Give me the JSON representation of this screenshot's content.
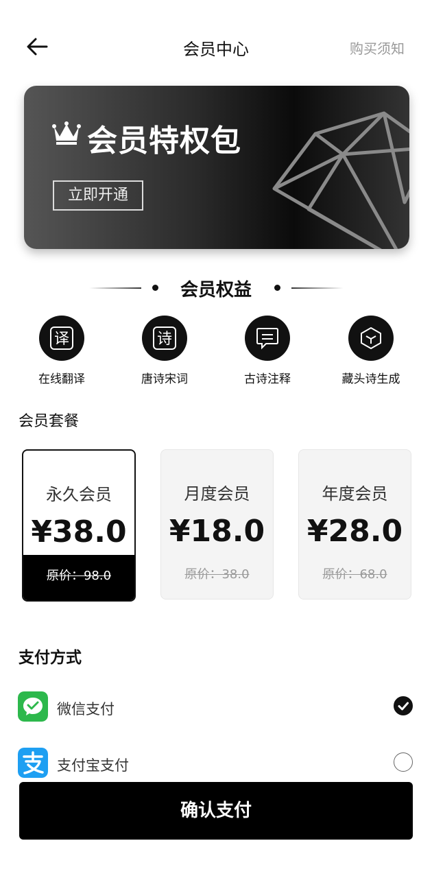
{
  "header": {
    "title": "会员中心",
    "notice_link": "购买须知"
  },
  "banner": {
    "title": "会员特权包",
    "cta": "立即开通"
  },
  "benefits": {
    "heading": "会员权益",
    "items": [
      {
        "label": "在线翻译",
        "glyph": "译",
        "icon": "translate-icon"
      },
      {
        "label": "唐诗宋词",
        "glyph": "诗",
        "icon": "poetry-icon"
      },
      {
        "label": "古诗注释",
        "icon": "comment-icon"
      },
      {
        "label": "藏头诗生成",
        "icon": "cube-icon"
      }
    ]
  },
  "plans": {
    "heading": "会员套餐",
    "items": [
      {
        "name": "永久会员",
        "price": "¥38.0",
        "original": "原价：98.0",
        "selected": true
      },
      {
        "name": "月度会员",
        "price": "¥18.0",
        "original": "原价：38.0",
        "selected": false
      },
      {
        "name": "年度会员",
        "price": "¥28.0",
        "original": "原价：68.0",
        "selected": false
      }
    ]
  },
  "payment": {
    "heading": "支付方式",
    "methods": [
      {
        "name": "微信支付",
        "icon": "wechat-pay-icon",
        "color": "#2DB84C",
        "selected": true
      },
      {
        "name": "支付宝支付",
        "icon": "alipay-icon",
        "color": "#1E9FF2",
        "selected": false
      }
    ],
    "confirm_label": "确认支付"
  }
}
